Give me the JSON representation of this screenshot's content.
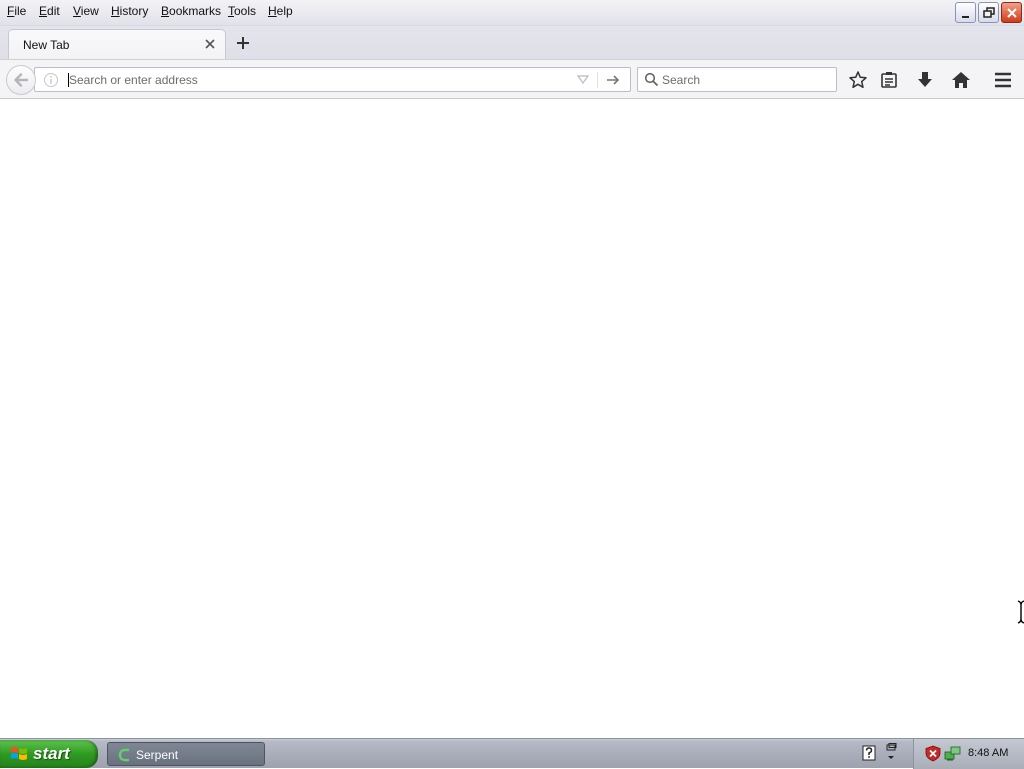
{
  "menubar": {
    "items": [
      "File",
      "Edit",
      "View",
      "History",
      "Bookmarks",
      "Tools",
      "Help"
    ]
  },
  "window_controls": {
    "minimize": "minimize-icon",
    "restore": "restore-icon",
    "close": "close-icon"
  },
  "tabs": [
    {
      "label": "New Tab",
      "active": true
    }
  ],
  "navbar": {
    "url_placeholder": "Search or enter address",
    "url_value": "",
    "search_placeholder": "Search",
    "icons": [
      "back-arrow-icon",
      "info-icon",
      "dropdown-icon",
      "go-arrow-icon",
      "search-icon",
      "bookmark-star-icon",
      "reading-list-icon",
      "download-icon",
      "home-icon",
      "menu-icon"
    ]
  },
  "taskbar": {
    "start_label": "start",
    "tasks": [
      {
        "label": "Serpent"
      }
    ],
    "clock": "8:48 AM"
  },
  "colors": {
    "start_green": "#2f9a21",
    "close_red": "#d23a18",
    "taskbar_gray": "#a9aeba"
  }
}
